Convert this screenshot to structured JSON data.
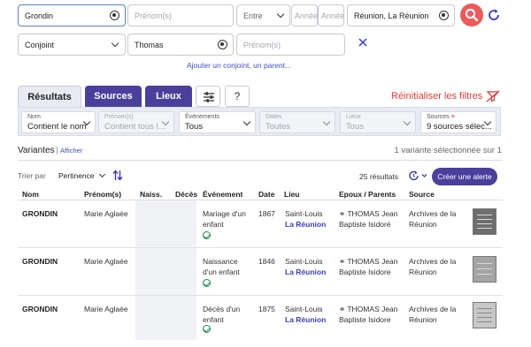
{
  "search": {
    "nom": "Grondin",
    "prenom_placeholder": "Prénom(s)",
    "entre_label": "Entre",
    "annee_placeholder_1": "Année",
    "annee_placeholder_2": "Année",
    "lieu": "Réunion, La Réunion",
    "relation": "Conjoint",
    "conjoint_nom": "Thomas",
    "conjoint_prenom_placeholder": "Prénom(s)",
    "add_link": "Ajouter un conjoint, un parent..."
  },
  "tabs": [
    {
      "label": "Résultats"
    },
    {
      "label": "Sources"
    },
    {
      "label": "Lieux"
    },
    {
      "label": "?"
    }
  ],
  "reset_label": "Réinitialiser les filtres",
  "filters": [
    {
      "label": "Nom",
      "value": "Contient le nom"
    },
    {
      "label": "Prénom(s)",
      "value": "Contient tous l..."
    },
    {
      "label": "Événements",
      "value": "Tous"
    },
    {
      "label": "Dates",
      "value": "Toutes"
    },
    {
      "label": "Lieux",
      "value": "Tous"
    },
    {
      "label": "Sources",
      "value": "9 sources sélec..."
    }
  ],
  "variantes": {
    "label": "Variantes",
    "show_link": "Afficher",
    "summary": "1 variante sélectionnée sur 1"
  },
  "sort": {
    "label": "Trier par",
    "value": "Pertinence"
  },
  "results_count": "25 résultats",
  "alert_button": "Créer une alerte",
  "columns": [
    "Nom",
    "Prénom(s)",
    "Naiss.",
    "Décès",
    "Événement",
    "Date",
    "Lieu",
    "Epoux / Parents",
    "Source"
  ],
  "rows": [
    {
      "nom": "GRONDIN",
      "prenom": "Marie Aglaée",
      "event1": "Mariage d'un",
      "event2": "enfant",
      "date": "1867",
      "lieu1": "Saint-Louis",
      "lieu2": "La Réunion",
      "epoux1": "THOMAS Jean",
      "epoux2": "Baptiste Isidoré",
      "source1": "Archives de la",
      "source2": "Réunion"
    },
    {
      "nom": "GRONDIN",
      "prenom": "Marie Aglaée",
      "event1": "Naissance",
      "event2": "d'un enfant",
      "date": "1846",
      "lieu1": "Saint-Louis",
      "lieu2": "La Réunion",
      "epoux1": "THOMAS Jean",
      "epoux2": "Baptiste Isidore",
      "source1": "Archives de la",
      "source2": "Réunion"
    },
    {
      "nom": "GRONDIN",
      "prenom": "Marie Aglaée",
      "event1": "Décès d'un",
      "event2": "enfant",
      "date": "1875",
      "lieu1": "Saint-Louis",
      "lieu2": "La Réunion",
      "epoux1": "THOMAS Jean",
      "epoux2": "Baptiste Isidore",
      "source1": "Archives de la",
      "source2": "Réunion"
    }
  ],
  "colors": {
    "accent": "#4b3f9c",
    "search_button": "#ec5a5a",
    "reset": "#e23b3b",
    "link": "#3d4fc4",
    "verified": "#1e8a4e"
  }
}
